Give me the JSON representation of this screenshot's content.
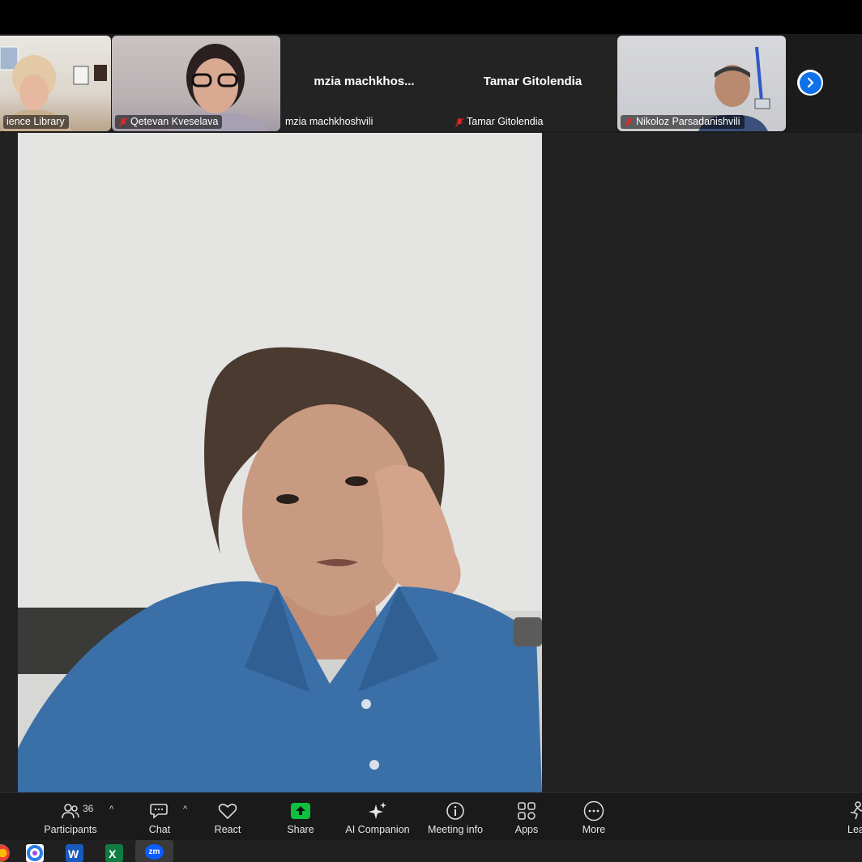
{
  "window": {
    "app": "Zoom Meeting"
  },
  "thumbnails": [
    {
      "name": "ience Library",
      "muted": false,
      "has_video": true
    },
    {
      "name": "Qetevan Kveselava",
      "muted": true,
      "has_video": true
    },
    {
      "name": "mzia machkhoshvili",
      "display_name": "mzia  machkhos...",
      "muted": false,
      "has_video": false
    },
    {
      "name": "Tamar Gitolendia",
      "display_name": "Tamar Gitolendia",
      "muted": true,
      "has_video": false
    },
    {
      "name": "Nikoloz Parsadanishvili",
      "muted": true,
      "has_video": true
    }
  ],
  "next_page_icon": "chevron-right-icon",
  "toolbar": {
    "participants": {
      "label": "Participants",
      "count": "36"
    },
    "chat": {
      "label": "Chat"
    },
    "react": {
      "label": "React"
    },
    "share": {
      "label": "Share"
    },
    "ai": {
      "label": "AI Companion"
    },
    "info": {
      "label": "Meeting info"
    },
    "apps": {
      "label": "Apps"
    },
    "more": {
      "label": "More"
    },
    "leave": {
      "label": "Lea"
    }
  },
  "colors": {
    "share_green": "#0fbf3e",
    "accent_blue": "#0e71eb",
    "mute_red": "#e02828"
  },
  "taskbar": {
    "icons": [
      "chrome-icon",
      "copilot-icon",
      "word-icon",
      "excel-icon",
      "zoom-icon"
    ]
  }
}
